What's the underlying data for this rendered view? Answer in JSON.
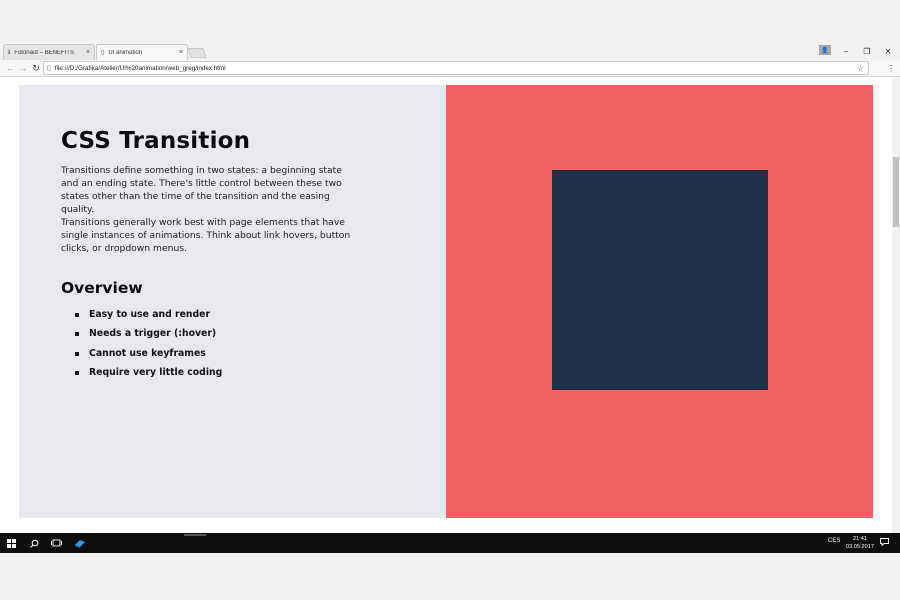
{
  "browser": {
    "tabs": [
      {
        "label": "Fotonaut – BENEFITS",
        "icon": "info-icon"
      },
      {
        "label": "UI animation",
        "icon": "page-icon"
      }
    ],
    "close_glyph": "×",
    "url": "file:///D:/Grafika/Atelier/UI%20animation/web_greg/index.html",
    "window_controls": {
      "minimize": "–",
      "maximize": "❐",
      "close": "✕"
    },
    "nav": {
      "back": "←",
      "forward": "→",
      "reload": "↻"
    },
    "star": "☆",
    "menu": "⋮"
  },
  "page": {
    "heading": "CSS Transition",
    "paragraph1": "Transitions define something in two states: a beginning state and an ending state. There's little control between these two states other than the time of the transition and the easing quality.",
    "paragraph2": "Transitions generally work best with page elements that have single instances of animations. Think about link hovers, button clicks, or dropdown menus.",
    "overview_title": "Overview",
    "overview_items": [
      "Easy to use and render",
      "Needs a trigger (:hover)",
      "Cannot use keyframes",
      "Require very little coding"
    ],
    "colors": {
      "left_panel": "#e8e8ef",
      "right_panel": "#f06262",
      "square": "#1d2f46"
    }
  },
  "taskbar": {
    "language": "CES",
    "time": "21:41",
    "date": "03.05.2017"
  }
}
